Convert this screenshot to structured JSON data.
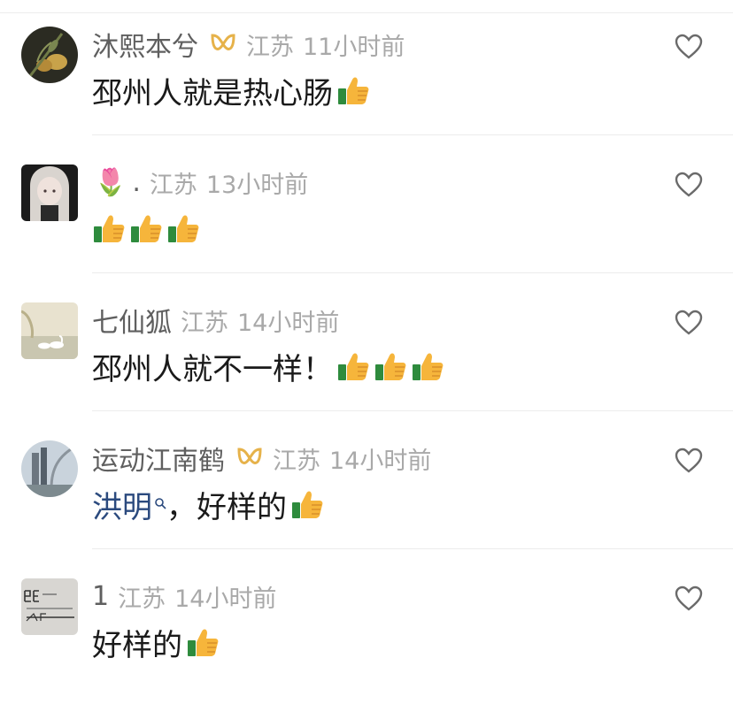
{
  "comments": [
    {
      "username": "沐熙本兮",
      "has_badge": true,
      "region": "江苏",
      "time": "11小时前",
      "text": "邳州人就是热心肠",
      "thumbs": 1
    },
    {
      "username": ".",
      "prefix_emoji": "🌷",
      "has_badge": false,
      "region": "江苏",
      "time": "13小时前",
      "text": "",
      "thumbs": 3
    },
    {
      "username": "七仙狐",
      "has_badge": false,
      "region": "江苏",
      "time": "14小时前",
      "text": "邳州人就不一样！",
      "thumbs": 3
    },
    {
      "username": "运动江南鹤",
      "has_badge": true,
      "region": "江苏",
      "time": "14小时前",
      "mention": "洪明",
      "text": "，好样的",
      "thumbs": 1
    },
    {
      "username": "1",
      "has_badge": false,
      "region": "江苏",
      "time": "14小时前",
      "text": "好样的",
      "thumbs": 1
    }
  ],
  "colors": {
    "username": "#5f5f5f",
    "meta": "#a9a9a9",
    "content": "#1a1a1a",
    "mention": "#2b4a7e",
    "badge": "#e6b24a"
  },
  "icons": {
    "like": "heart-outline-icon",
    "badge": "ribbon-badge-icon",
    "emoji": "thumbs-up-emoji",
    "mention": "search-icon"
  }
}
